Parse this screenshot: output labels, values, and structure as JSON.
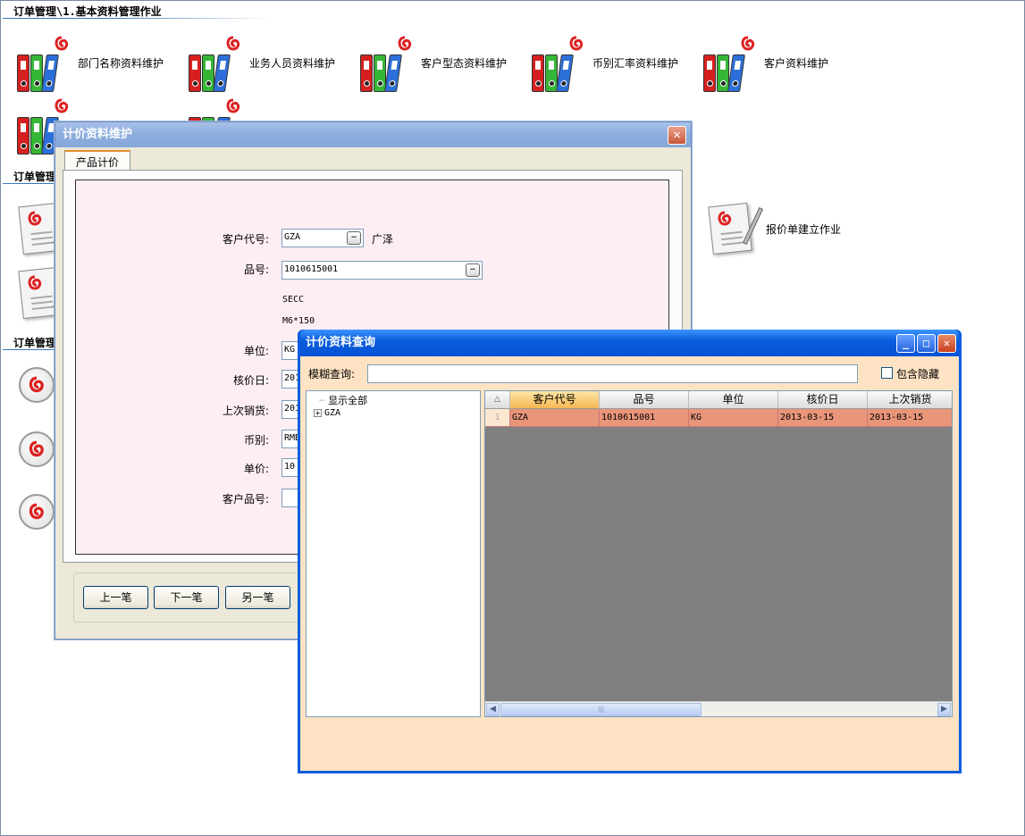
{
  "section1": {
    "title": "订单管理\\1.基本资料管理作业"
  },
  "section2": {
    "title": "订单管理"
  },
  "section3": {
    "title": "订单管理"
  },
  "modules_row1": [
    {
      "label": "部门名称资料维护"
    },
    {
      "label": "业务人员资料维护"
    },
    {
      "label": "客户型态资料维护"
    },
    {
      "label": "币别汇率资料维护"
    },
    {
      "label": "客户资料维护"
    }
  ],
  "quote_module": {
    "label": "报价单建立作业"
  },
  "icons": {
    "binder": "binder-folder-icon",
    "document": "document-pen-icon",
    "magnifier": "magnifier-icon",
    "logo": "app-logo-icon"
  },
  "colors": {
    "form_bg": "#fdeef3",
    "query_bg": "#fde3c4",
    "selected_row": "#e8957a",
    "xp_blue": "#0a5ddc"
  },
  "pricing_window": {
    "title": "计价资料维护",
    "close": "✕",
    "tab": "产品计价",
    "fields": {
      "customer_code": {
        "label": "客户代号:",
        "value": "GZA",
        "name": "广泽"
      },
      "part_no": {
        "label": "品号:",
        "value": "1010615001",
        "desc1": "SECC",
        "desc2": "M6*150"
      },
      "unit": {
        "label": "单位:",
        "value": "KG"
      },
      "price_date": {
        "label": "核价日:",
        "value": "201"
      },
      "last_sale": {
        "label": "上次销货:",
        "value": "201"
      },
      "currency": {
        "label": "币别:",
        "value": "RMB"
      },
      "price": {
        "label": "单价:",
        "value": "10"
      },
      "customer_part": {
        "label": "客户品号:",
        "value": ""
      }
    },
    "buttons": {
      "prev": "上一笔",
      "next": "下一笔",
      "other": "另一笔"
    }
  },
  "query_window": {
    "title": "计价资料查询",
    "minimize": "_",
    "maximize": "□",
    "close": "✕",
    "search_label": "模糊查询:",
    "search_value": "",
    "include_hidden": "包含隐藏",
    "tree": {
      "root": "显示全部",
      "child": "GZA",
      "expander": "+"
    },
    "grid": {
      "indicator_header": "△",
      "headers": [
        "客户代号",
        "品号",
        "单位",
        "核价日",
        "上次销货"
      ],
      "rows": [
        {
          "index": "1",
          "cells": [
            "GZA",
            "1010615001",
            "KG",
            "2013-03-15",
            "2013-03-15"
          ]
        }
      ],
      "scroll_left": "◀",
      "scroll_right": "▶",
      "thumb_grip": "|||"
    }
  }
}
